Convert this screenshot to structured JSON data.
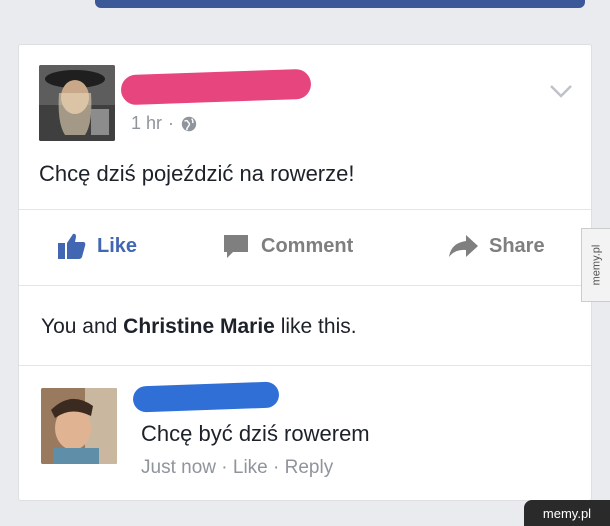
{
  "post": {
    "timestamp": "1 hr",
    "separator": "·",
    "privacy_icon": "globe-icon",
    "text": "Chcę dziś pojeździć na rowerze!",
    "options_icon": "chevron-down-icon"
  },
  "actions": {
    "like": "Like",
    "comment": "Comment",
    "share": "Share"
  },
  "likes": {
    "prefix": "You and ",
    "name": "Christine Marie",
    "suffix": " like this."
  },
  "comment": {
    "text": "Chcę być dziś rowerem",
    "time": "Just now",
    "like": "Like",
    "reply": "Reply"
  },
  "side_tag": "memy.pl",
  "watermark": "memy.pl",
  "colors": {
    "brand": "#3b5998",
    "like_blue": "#4267b2",
    "redact_pink": "#e6467d",
    "redact_blue": "#2f6fd6"
  }
}
